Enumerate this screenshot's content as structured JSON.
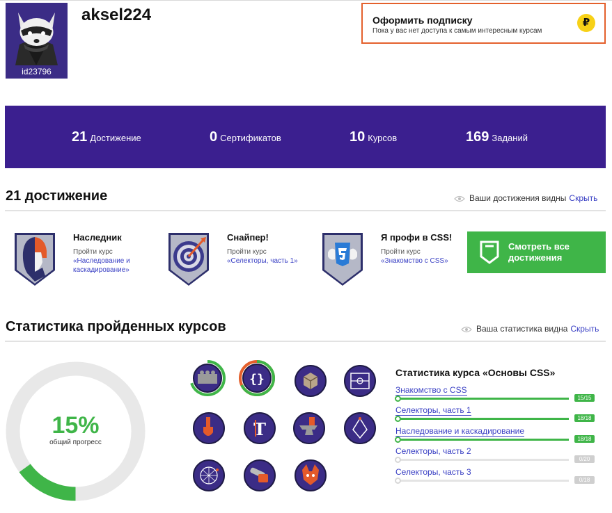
{
  "profile": {
    "username": "aksel224",
    "user_id": "id23796"
  },
  "subscription": {
    "title": "Оформить подписку",
    "text": "Пока у вас нет доступа к самым интересным курсам",
    "icon": "ruble-coin-icon",
    "icon_glyph": "₽"
  },
  "stats": [
    {
      "value": "21",
      "label": "Достижение"
    },
    {
      "value": "0",
      "label": "Сертификатов"
    },
    {
      "value": "10",
      "label": "Курсов"
    },
    {
      "value": "169",
      "label": "Заданий"
    }
  ],
  "achievements_section": {
    "title": "21 достижение",
    "visibility_text": "Ваши достижения видны",
    "hide_link": "Скрыть"
  },
  "achievements": [
    {
      "title": "Наследник",
      "desc": "Пройти курс",
      "link": "«Наследование и каскадирование»",
      "icon": "heir-badge-icon"
    },
    {
      "title": "Снайпер!",
      "desc": "Пройти курс",
      "link": "«Селекторы, часть 1»",
      "icon": "target-badge-icon"
    },
    {
      "title": "Я профи в CSS!",
      "desc": "Пройти курс",
      "link": "«Знакомство с CSS»",
      "icon": "css3-badge-icon"
    }
  ],
  "see_all": {
    "label": "Смотреть все достижения",
    "icon": "badge-outline-icon"
  },
  "course_stats_section": {
    "title": "Статистика пройденных курсов",
    "visibility_text": "Ваша статистика видна",
    "hide_link": "Скрыть"
  },
  "overall_progress": {
    "percent": 15,
    "percent_label": "15%",
    "label": "общий прогресс"
  },
  "course_icons": [
    {
      "name": "lego-brick-icon",
      "progress": 0.7,
      "active": false
    },
    {
      "name": "css-braces-icon",
      "progress": 1.0,
      "active": true
    },
    {
      "name": "cube-icon",
      "progress": 0,
      "active": false
    },
    {
      "name": "football-field-icon",
      "progress": 0,
      "active": false
    },
    {
      "name": "paint-brush-icon",
      "progress": 0,
      "active": false
    },
    {
      "name": "typography-icon",
      "progress": 0,
      "active": false
    },
    {
      "name": "anvil-icon",
      "progress": 0,
      "active": false
    },
    {
      "name": "vector-pen-icon",
      "progress": 0,
      "active": false
    },
    {
      "name": "network-sphere-icon",
      "progress": 0,
      "active": false
    },
    {
      "name": "chainsaw-icon",
      "progress": 0,
      "active": false
    },
    {
      "name": "fox-icon",
      "progress": 0,
      "active": false
    }
  ],
  "course_stats": {
    "title": "Статистика курса «Основы CSS»",
    "items": [
      {
        "name": "Знакомство с CSS",
        "done": 15,
        "total": 15,
        "badge": "15/15"
      },
      {
        "name": "Селекторы, часть 1",
        "done": 18,
        "total": 18,
        "badge": "18/18"
      },
      {
        "name": "Наследование и каскадирование",
        "done": 18,
        "total": 18,
        "badge": "18/18"
      },
      {
        "name": "Селекторы, часть 2",
        "done": 0,
        "total": 20,
        "badge": "0/20"
      },
      {
        "name": "Селекторы, часть 3",
        "done": 0,
        "total": 18,
        "badge": "0/18"
      }
    ]
  },
  "colors": {
    "brand_purple": "#3b1f8f",
    "accent_green": "#3fb548",
    "accent_orange": "#e4602c",
    "link_blue": "#3a40c4"
  }
}
